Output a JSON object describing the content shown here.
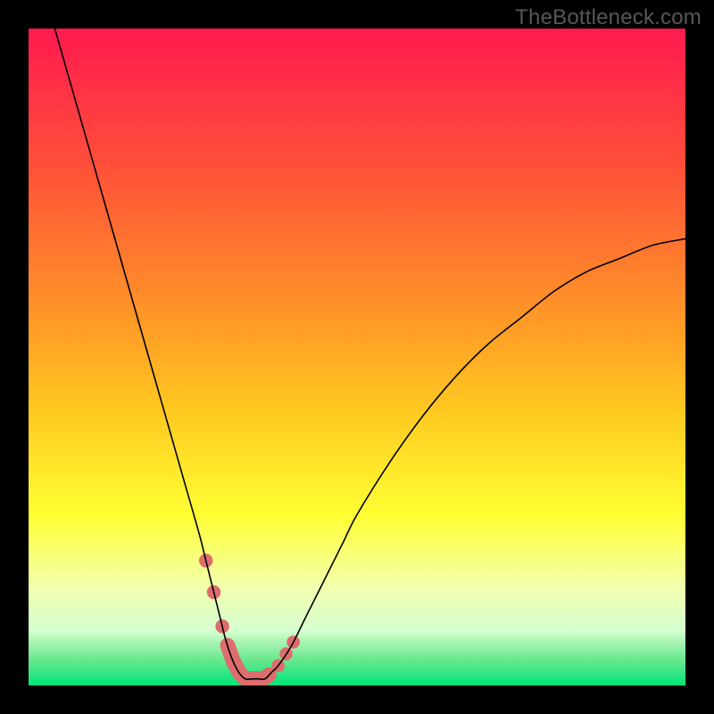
{
  "watermark": "TheBottleneck.com",
  "chart_data": {
    "type": "line",
    "title": "",
    "xlabel": "",
    "ylabel": "",
    "xlim": [
      0,
      100
    ],
    "ylim": [
      0,
      100
    ],
    "grid": false,
    "legend": false,
    "background_gradient": {
      "stops": [
        {
          "offset": 0.0,
          "color": "#ff1a4f"
        },
        {
          "offset": 0.2,
          "color": "#ff4d3a"
        },
        {
          "offset": 0.4,
          "color": "#ff8a2a"
        },
        {
          "offset": 0.58,
          "color": "#ffc81f"
        },
        {
          "offset": 0.74,
          "color": "#ffff33"
        },
        {
          "offset": 0.85,
          "color": "#f2ffad"
        },
        {
          "offset": 0.915,
          "color": "#d7ffd0"
        },
        {
          "offset": 0.96,
          "color": "#6be88f"
        },
        {
          "offset": 1.0,
          "color": "#00e57a"
        }
      ]
    },
    "series": [
      {
        "name": "curve",
        "color": "#000000",
        "x": [
          4,
          6,
          8,
          10,
          12,
          14,
          16,
          18,
          20,
          22,
          24,
          26,
          27,
          28,
          29,
          30,
          31,
          32,
          33,
          34,
          35,
          36,
          37,
          38,
          40,
          42,
          44,
          46,
          48,
          50,
          55,
          60,
          65,
          70,
          75,
          80,
          85,
          90,
          95,
          100
        ],
        "y": [
          100,
          93,
          86,
          79,
          72,
          65,
          58,
          51,
          44,
          37,
          30,
          23,
          19,
          15,
          11,
          7,
          4,
          2,
          1,
          1,
          1,
          1,
          2,
          3,
          6,
          10,
          14,
          18,
          22,
          26,
          34,
          41,
          47,
          52,
          56,
          60,
          63,
          65,
          67,
          68
        ]
      }
    ],
    "markers": {
      "name": "marker-band",
      "color": "#de6d6d",
      "x_range": [
        27,
        40
      ],
      "shape": "rounded-segments"
    }
  }
}
